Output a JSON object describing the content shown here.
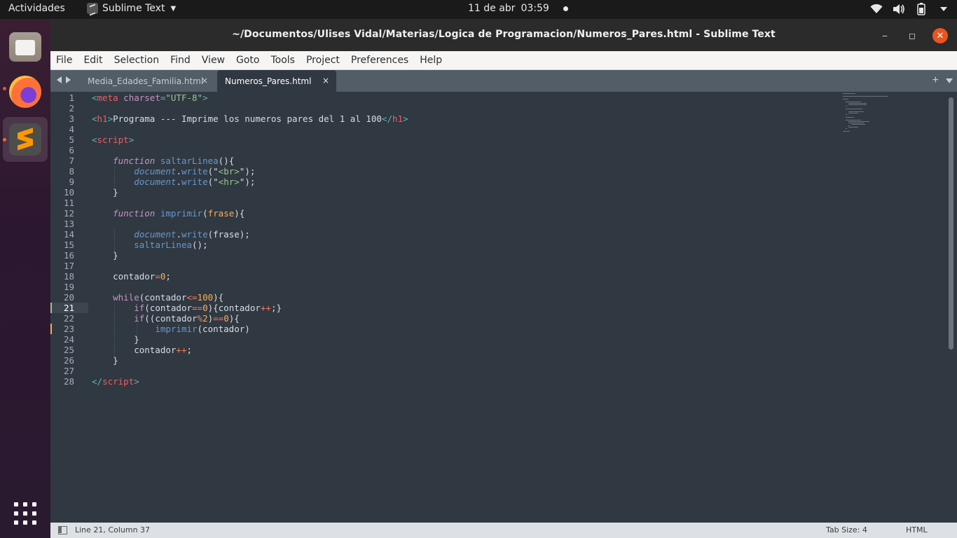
{
  "topbar": {
    "activities": "Actividades",
    "app_name": "Sublime Text",
    "date": "11 de abr",
    "time": "03:59",
    "icons": [
      "wifi-icon",
      "volume-icon",
      "battery-icon",
      "power-menu-icon"
    ]
  },
  "dock": {
    "items": [
      "files-icon",
      "firefox-icon",
      "sublime-text-icon"
    ],
    "show_apps": "show-applications-icon"
  },
  "window": {
    "title": "~/Documentos/Ulises Vidal/Materias/Logica de Programacion/Numeros_Pares.html - Sublime Text",
    "minimize": "‒",
    "maximize": "◻",
    "close": "✕"
  },
  "menu": [
    "File",
    "Edit",
    "Selection",
    "Find",
    "View",
    "Goto",
    "Tools",
    "Project",
    "Preferences",
    "Help"
  ],
  "tabs": [
    {
      "label": "Media_Edades_Familia.html",
      "active": false
    },
    {
      "label": "Numeros_Pares.html",
      "active": true
    }
  ],
  "tab_close": "×",
  "tab_add": "+",
  "editor": {
    "current_line": 21,
    "line_count": 28,
    "modified_lines": [
      21,
      23
    ],
    "lines": [
      [
        [
          "<",
          "c-punc"
        ],
        [
          "meta",
          "c-tag"
        ],
        [
          " ",
          ""
        ],
        [
          "charset",
          "c-attr"
        ],
        [
          "=",
          "c-punc"
        ],
        [
          "\"UTF-8\"",
          "c-str"
        ],
        [
          ">",
          "c-punc"
        ]
      ],
      [],
      [
        [
          "<",
          "c-punc"
        ],
        [
          "h1",
          "c-tag"
        ],
        [
          ">",
          "c-punc"
        ],
        [
          "Programa --- Imprime los numeros pares del 1 al 100",
          ""
        ],
        [
          "</",
          "c-punc"
        ],
        [
          "h1",
          "c-tag"
        ],
        [
          ">",
          "c-punc"
        ]
      ],
      [],
      [
        [
          "<",
          "c-punc"
        ],
        [
          "script",
          "c-tag"
        ],
        [
          ">",
          "c-punc"
        ]
      ],
      [],
      [
        [
          "    ",
          ""
        ],
        [
          "function",
          "c-kw"
        ],
        [
          " ",
          ""
        ],
        [
          "saltarLinea",
          "c-fn"
        ],
        [
          "(){",
          ""
        ]
      ],
      [
        [
          "        ",
          ""
        ],
        [
          "document",
          "c-obj"
        ],
        [
          ".",
          ""
        ],
        [
          "write",
          "c-fn"
        ],
        [
          "(",
          ""
        ],
        [
          "\"",
          ""
        ],
        [
          "<br>",
          "c-str"
        ],
        [
          "\"",
          ""
        ],
        [
          ");",
          ""
        ]
      ],
      [
        [
          "        ",
          ""
        ],
        [
          "document",
          "c-obj"
        ],
        [
          ".",
          ""
        ],
        [
          "write",
          "c-fn"
        ],
        [
          "(",
          ""
        ],
        [
          "\"",
          ""
        ],
        [
          "<hr>",
          "c-str"
        ],
        [
          "\"",
          ""
        ],
        [
          ");",
          ""
        ]
      ],
      [
        [
          "    }",
          ""
        ]
      ],
      [],
      [
        [
          "    ",
          ""
        ],
        [
          "function",
          "c-kw"
        ],
        [
          " ",
          ""
        ],
        [
          "imprimir",
          "c-fn"
        ],
        [
          "(",
          ""
        ],
        [
          "frase",
          "c-param"
        ],
        [
          "){",
          ""
        ]
      ],
      [],
      [
        [
          "        ",
          ""
        ],
        [
          "document",
          "c-obj"
        ],
        [
          ".",
          ""
        ],
        [
          "write",
          "c-fn"
        ],
        [
          "(frase);",
          ""
        ]
      ],
      [
        [
          "        ",
          ""
        ],
        [
          "saltarLinea",
          "c-fn"
        ],
        [
          "();",
          ""
        ]
      ],
      [
        [
          "    }",
          ""
        ]
      ],
      [],
      [
        [
          "    contador",
          ""
        ],
        [
          "=",
          "c-op"
        ],
        [
          "0",
          "c-num"
        ],
        [
          ";",
          ""
        ]
      ],
      [],
      [
        [
          "    ",
          ""
        ],
        [
          "while",
          "c-ctrl"
        ],
        [
          "(contador",
          ""
        ],
        [
          "<=",
          "c-op"
        ],
        [
          "100",
          "c-num"
        ],
        [
          "){",
          ""
        ]
      ],
      [
        [
          "        ",
          ""
        ],
        [
          "if",
          "c-ctrl"
        ],
        [
          "(contador",
          ""
        ],
        [
          "==",
          "c-op"
        ],
        [
          "0",
          "c-num"
        ],
        [
          "){contador",
          ""
        ],
        [
          "++",
          "c-op"
        ],
        [
          ";}",
          ""
        ]
      ],
      [
        [
          "        ",
          ""
        ],
        [
          "if",
          "c-ctrl"
        ],
        [
          "((contador",
          ""
        ],
        [
          "%",
          "c-op"
        ],
        [
          "2",
          "c-num"
        ],
        [
          ")",
          ""
        ],
        [
          "==",
          "c-op"
        ],
        [
          "0",
          "c-num"
        ],
        [
          "){",
          ""
        ]
      ],
      [
        [
          "            ",
          ""
        ],
        [
          "imprimir",
          "c-fn"
        ],
        [
          "(contador)",
          ""
        ]
      ],
      [
        [
          "        }",
          ""
        ]
      ],
      [
        [
          "        contador",
          ""
        ],
        [
          "++",
          "c-op"
        ],
        [
          ";",
          ""
        ]
      ],
      [
        [
          "    }",
          ""
        ]
      ],
      [],
      [
        [
          "</",
          "c-punc"
        ],
        [
          "script",
          "c-tag"
        ],
        [
          ">",
          "c-punc"
        ]
      ]
    ]
  },
  "status": {
    "position": "Line 21, Column 37",
    "tab_size": "Tab Size: 4",
    "syntax": "HTML"
  },
  "colors": {
    "editor_bg": "#303841",
    "accent": "#e95420",
    "modified_mark": "#f9ae58",
    "saved_mark": "#99c794"
  }
}
